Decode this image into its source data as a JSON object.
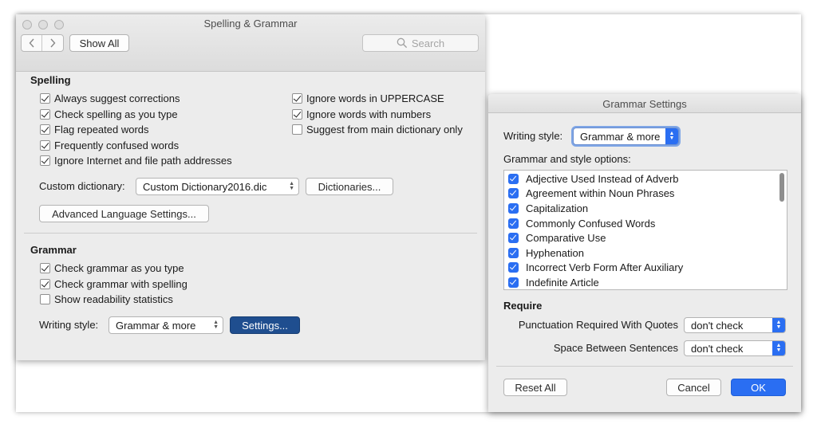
{
  "main_window": {
    "title": "Spelling & Grammar",
    "toolbar": {
      "back_icon": "chevron-left-icon",
      "forward_icon": "chevron-right-icon",
      "show_all_label": "Show All",
      "search_placeholder": "Search"
    },
    "spelling": {
      "heading": "Spelling",
      "left_options": [
        {
          "label": "Always suggest corrections",
          "checked": true
        },
        {
          "label": "Check spelling as you type",
          "checked": true
        },
        {
          "label": "Flag repeated words",
          "checked": true
        },
        {
          "label": "Frequently confused words",
          "checked": true
        },
        {
          "label": "Ignore Internet and file path addresses",
          "checked": true
        }
      ],
      "right_options": [
        {
          "label": "Ignore words in UPPERCASE",
          "checked": true
        },
        {
          "label": "Ignore words with numbers",
          "checked": true
        },
        {
          "label": "Suggest from main dictionary only",
          "checked": false
        }
      ],
      "custom_dictionary_label": "Custom dictionary:",
      "custom_dictionary_value": "Custom Dictionary2016.dic",
      "dictionaries_button": "Dictionaries...",
      "advanced_button": "Advanced Language Settings..."
    },
    "grammar": {
      "heading": "Grammar",
      "options": [
        {
          "label": "Check grammar as you type",
          "checked": true
        },
        {
          "label": "Check grammar with spelling",
          "checked": true
        },
        {
          "label": "Show readability statistics",
          "checked": false
        }
      ],
      "writing_style_label": "Writing style:",
      "writing_style_value": "Grammar & more",
      "settings_button": "Settings..."
    }
  },
  "dialog": {
    "title": "Grammar Settings",
    "writing_style_label": "Writing style:",
    "writing_style_value": "Grammar & more",
    "options_heading": "Grammar and style options:",
    "options": [
      {
        "label": "Adjective Used Instead of Adverb",
        "checked": true
      },
      {
        "label": "Agreement within Noun Phrases",
        "checked": true
      },
      {
        "label": "Capitalization",
        "checked": true
      },
      {
        "label": "Commonly Confused Words",
        "checked": true
      },
      {
        "label": "Comparative Use",
        "checked": true
      },
      {
        "label": "Hyphenation",
        "checked": true
      },
      {
        "label": "Incorrect Verb Form After Auxiliary",
        "checked": true
      },
      {
        "label": "Indefinite Article",
        "checked": true
      }
    ],
    "require_heading": "Require",
    "punctuation_label": "Punctuation Required With Quotes",
    "punctuation_value": "don't check",
    "space_label": "Space Between Sentences",
    "space_value": "don't check",
    "reset_button": "Reset All",
    "cancel_button": "Cancel",
    "ok_button": "OK"
  },
  "colors": {
    "accent_blue": "#2a6ef2",
    "default_button_blue": "#1f4e8f",
    "window_bg": "#ececec"
  }
}
